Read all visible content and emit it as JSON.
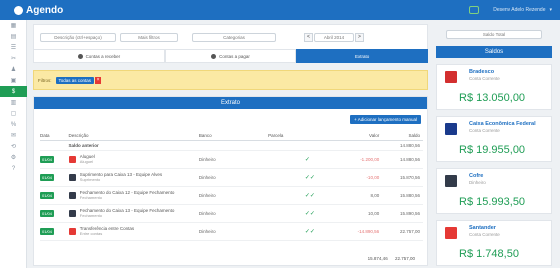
{
  "app": {
    "name": "Agendo"
  },
  "topbar": {
    "user_label": "Desenv Adelo Rezende"
  },
  "sidebar": {
    "active_index": 6
  },
  "filters": {
    "search_placeholder": "Descrição (ctrl+espaço)",
    "filter_select": "Mais filtros",
    "category_select": "Categorias",
    "prev": "<",
    "period": "Abril 2014",
    "next": ">"
  },
  "tabs": [
    {
      "label": "Contas a receber",
      "active": false
    },
    {
      "label": "Contas a pagar",
      "active": false
    },
    {
      "label": "Extrato",
      "active": true
    }
  ],
  "alert": {
    "label": "Filtros:",
    "tag": "Todas as contas",
    "close": "×"
  },
  "panel": {
    "title": "Extrato",
    "add_button": "+ Adicionar lançamento manual",
    "columns": [
      "Data",
      "Descrição",
      "Banco",
      "Parcela",
      "",
      "Valor",
      "Saldo"
    ],
    "opening": {
      "label": "Saldo anterior",
      "saldo": "14.880,56"
    },
    "rows": [
      {
        "date": "01/04",
        "bank_color": "#e53935",
        "desc": "Aluguel",
        "sub": "Aluguel",
        "banco": "Dinheiro",
        "parcela": "",
        "check": "✓",
        "valor": "-1.200,00",
        "negative": true,
        "saldo": "14.880,56"
      },
      {
        "date": "01/04",
        "bank_color": "#333b4a",
        "desc": "Suprimento para Caixa 13 - Equipe Alves",
        "sub": "Suprimento",
        "banco": "Dinheiro",
        "parcela": "",
        "check": "✓✓",
        "valor": "-10,00",
        "negative": true,
        "saldo": "15.870,56"
      },
      {
        "date": "01/04",
        "bank_color": "#333b4a",
        "desc": "Fechamento do Caixa 12 - Equipe Fechamento",
        "sub": "Fechamento",
        "banco": "Dinheiro",
        "parcela": "",
        "check": "✓✓",
        "valor": "8,00",
        "negative": false,
        "saldo": "15.880,56"
      },
      {
        "date": "01/04",
        "bank_color": "#333b4a",
        "desc": "Fechamento do Caixa 13 - Equipe Fechamento",
        "sub": "Fechamento",
        "banco": "Dinheiro",
        "parcela": "",
        "check": "✓✓",
        "valor": "10,00",
        "negative": false,
        "saldo": "15.890,56"
      },
      {
        "date": "01/04",
        "bank_color": "#e53935",
        "desc": "Transferência entre Contas",
        "sub": "Entre contas",
        "banco": "Dinheiro",
        "parcela": "",
        "check": "✓✓",
        "valor": "-14.890,56",
        "negative": true,
        "saldo": "22.757,00"
      }
    ],
    "totals": {
      "valor": "15.874,46",
      "saldo": "22.757,00"
    }
  },
  "rightcol": {
    "button": "Saldo Total",
    "title": "Saldos",
    "banks": [
      {
        "name": "Bradesco",
        "type": "Conta Corrente",
        "balance": "R$ 13.050,00",
        "color": "#d32f2f"
      },
      {
        "name": "Caixa Econômica Federal",
        "type": "Conta Corrente",
        "balance": "R$ 19.955,00",
        "color": "#1a3a8c"
      },
      {
        "name": "Cofre",
        "type": "Dinheiro",
        "balance": "R$ 15.993,50",
        "color": "#333b4a"
      },
      {
        "name": "Santander",
        "type": "Conta Corrente",
        "balance": "R$ 1.748,50",
        "color": "#e53935"
      }
    ]
  }
}
